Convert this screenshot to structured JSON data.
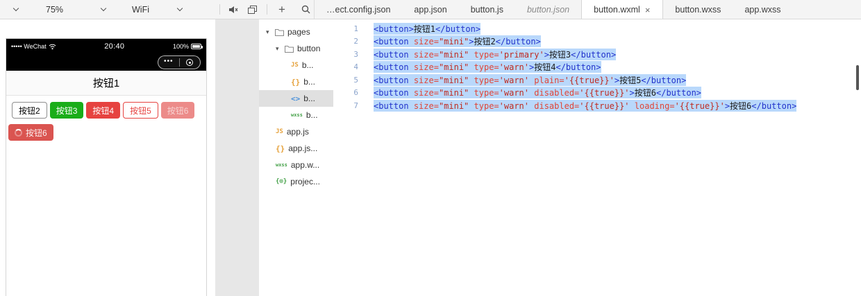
{
  "toolbar": {
    "zoom_value": "75%",
    "network_value": "WiFi",
    "add_label": "+"
  },
  "icons": {
    "device_dropdown": "chevron-down",
    "mute": "speaker",
    "layout": "overlapping-windows",
    "search": "magnifier",
    "tab_close": "×",
    "tree_expanded": "▾",
    "capsule_more": "•••",
    "capsule_home": "circle-dot"
  },
  "tabs": {
    "items": [
      {
        "label": "…ect.config.json",
        "active": false,
        "preview": false
      },
      {
        "label": "app.json",
        "active": false,
        "preview": false
      },
      {
        "label": "button.js",
        "active": false,
        "preview": false
      },
      {
        "label": "button.json",
        "active": false,
        "preview": true
      },
      {
        "label": "button.wxml",
        "active": true,
        "preview": false
      },
      {
        "label": "button.wxss",
        "active": false,
        "preview": false
      },
      {
        "label": "app.wxss",
        "active": false,
        "preview": false
      }
    ]
  },
  "simulator": {
    "status": {
      "carrier": "••••• WeChat",
      "time": "20:40",
      "battery_pct": "100%"
    },
    "page_title": "按钮1",
    "buttons": [
      {
        "label": "按钮2",
        "kind": "default"
      },
      {
        "label": "按钮3",
        "kind": "primary"
      },
      {
        "label": "按钮4",
        "kind": "warn"
      },
      {
        "label": "按钮5",
        "kind": "warn-plain"
      },
      {
        "label": "按钮6",
        "kind": "warn-disabled"
      }
    ],
    "loading_button": {
      "label": "按钮6",
      "kind": "warn-loading"
    }
  },
  "file_tree": {
    "icon_labels": {
      "js": "JS",
      "json": "{}",
      "wxml": "<>",
      "wxss": "wxss",
      "config": "{⊙}"
    },
    "items": [
      {
        "label": "pages",
        "type": "folder",
        "depth": 0,
        "expanded": true,
        "selected": false
      },
      {
        "label": "button",
        "type": "folder",
        "depth": 1,
        "expanded": true,
        "selected": false
      },
      {
        "label": "b...",
        "type": "js",
        "depth": 2,
        "selected": false
      },
      {
        "label": "b...",
        "type": "json",
        "depth": 2,
        "selected": false
      },
      {
        "label": "b...",
        "type": "wxml",
        "depth": 2,
        "selected": true
      },
      {
        "label": "b...",
        "type": "wxss",
        "depth": 2,
        "selected": false
      },
      {
        "label": "app.js",
        "type": "js",
        "depth": 1,
        "selected": false
      },
      {
        "label": "app.js...",
        "type": "json",
        "depth": 1,
        "selected": false
      },
      {
        "label": "app.w...",
        "type": "wxss",
        "depth": 1,
        "selected": false
      },
      {
        "label": "projec...",
        "type": "config",
        "depth": 1,
        "selected": false
      }
    ]
  },
  "editor": {
    "selection": "all-lines",
    "lines": [
      {
        "num": 1,
        "tokens": [
          [
            "tag",
            "<button>"
          ],
          [
            "txt",
            "按钮1"
          ],
          [
            "tag",
            "</button>"
          ]
        ]
      },
      {
        "num": 2,
        "tokens": [
          [
            "tag",
            "<button"
          ],
          [
            "pln",
            " "
          ],
          [
            "attr",
            "size="
          ],
          [
            "str",
            "\"mini\""
          ],
          [
            "tag",
            ">"
          ],
          [
            "txt",
            "按钮2"
          ],
          [
            "tag",
            "</button>"
          ]
        ]
      },
      {
        "num": 3,
        "tokens": [
          [
            "tag",
            "<button"
          ],
          [
            "pln",
            " "
          ],
          [
            "attr",
            "size="
          ],
          [
            "str",
            "\"mini\""
          ],
          [
            "pln",
            " "
          ],
          [
            "attr",
            "type="
          ],
          [
            "str",
            "'primary'"
          ],
          [
            "tag",
            ">"
          ],
          [
            "txt",
            "按钮3"
          ],
          [
            "tag",
            "</button>"
          ]
        ]
      },
      {
        "num": 4,
        "tokens": [
          [
            "tag",
            "<button"
          ],
          [
            "pln",
            " "
          ],
          [
            "attr",
            "size="
          ],
          [
            "str",
            "\"mini\""
          ],
          [
            "pln",
            " "
          ],
          [
            "attr",
            "type="
          ],
          [
            "str",
            "'warn'"
          ],
          [
            "tag",
            ">"
          ],
          [
            "txt",
            "按钮4"
          ],
          [
            "tag",
            "</button>"
          ]
        ]
      },
      {
        "num": 5,
        "tokens": [
          [
            "tag",
            "<button"
          ],
          [
            "pln",
            " "
          ],
          [
            "attr",
            "size="
          ],
          [
            "str",
            "\"mini\""
          ],
          [
            "pln",
            " "
          ],
          [
            "attr",
            "type="
          ],
          [
            "str",
            "'warn'"
          ],
          [
            "pln",
            " "
          ],
          [
            "attr",
            "plain="
          ],
          [
            "str",
            "'{{true}}'"
          ],
          [
            "tag",
            ">"
          ],
          [
            "txt",
            "按钮5"
          ],
          [
            "tag",
            "</button>"
          ]
        ]
      },
      {
        "num": 6,
        "tokens": [
          [
            "tag",
            "<button"
          ],
          [
            "pln",
            " "
          ],
          [
            "attr",
            "size="
          ],
          [
            "str",
            "\"mini\""
          ],
          [
            "pln",
            " "
          ],
          [
            "attr",
            "type="
          ],
          [
            "str",
            "'warn'"
          ],
          [
            "pln",
            " "
          ],
          [
            "attr",
            "disabled="
          ],
          [
            "str",
            "'{{true}}'"
          ],
          [
            "tag",
            ">"
          ],
          [
            "txt",
            "按钮6"
          ],
          [
            "tag",
            "</button>"
          ]
        ]
      },
      {
        "num": 7,
        "tokens": [
          [
            "tag",
            "<button"
          ],
          [
            "pln",
            " "
          ],
          [
            "attr",
            "size="
          ],
          [
            "str",
            "\"mini\""
          ],
          [
            "pln",
            " "
          ],
          [
            "attr",
            "type="
          ],
          [
            "str",
            "'warn'"
          ],
          [
            "pln",
            " "
          ],
          [
            "attr",
            "disabled="
          ],
          [
            "str",
            "'{{true}}'"
          ],
          [
            "pln",
            " "
          ],
          [
            "attr",
            "loading="
          ],
          [
            "str",
            "'{{true}}'"
          ],
          [
            "tag",
            ">"
          ],
          [
            "txt",
            "按钮6"
          ],
          [
            "tag",
            "</button>"
          ]
        ]
      }
    ]
  },
  "colors": {
    "primary_green": "#1aad19",
    "warn_red": "#e64340",
    "selection_blue": "#b9d8fb",
    "tag_blue": "#2233cc",
    "attr_red": "#e04537",
    "string_red": "#bf2b20"
  }
}
